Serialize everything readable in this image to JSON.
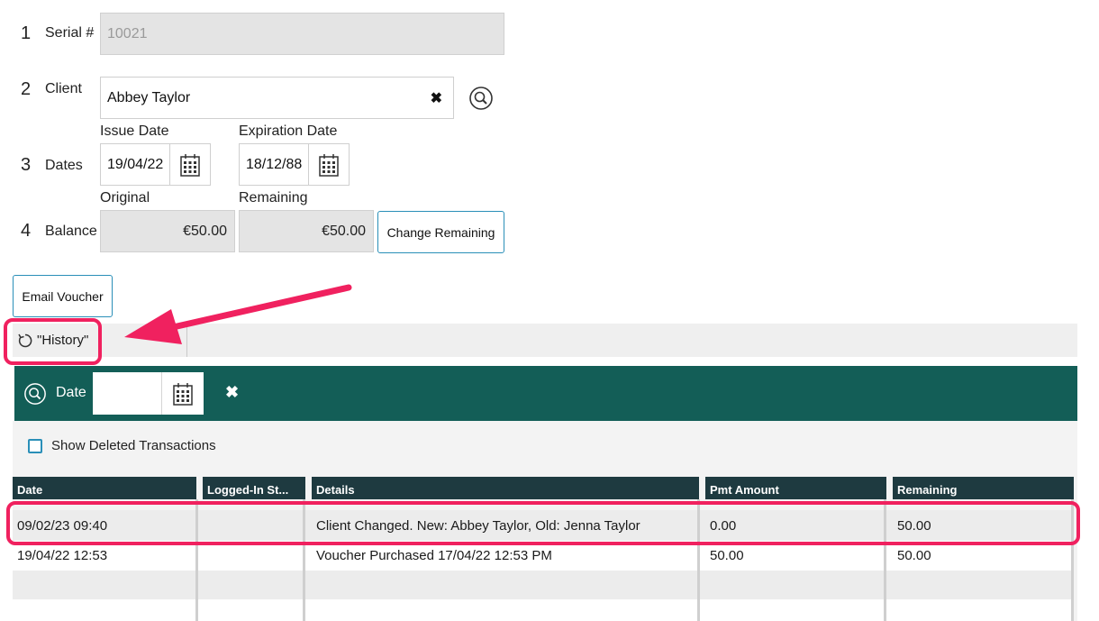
{
  "form": {
    "serial": {
      "num": "1",
      "label": "Serial #",
      "value": "10021"
    },
    "client": {
      "num": "2",
      "label": "Client",
      "value": "Abbey Taylor"
    },
    "dates": {
      "num": "3",
      "label": "Dates",
      "issue_label": "Issue Date",
      "issue_value": "19/04/22",
      "expiration_label": "Expiration Date",
      "expiration_value": "18/12/88"
    },
    "balance": {
      "num": "4",
      "label": "Balance",
      "original_label": "Original",
      "original_value": "€50.00",
      "remaining_label": "Remaining",
      "remaining_value": "€50.00",
      "change_button": "Change Remaining"
    }
  },
  "email_button": "Email Voucher",
  "tab": {
    "label": "\"History\""
  },
  "filter": {
    "date_label": "Date",
    "date_value": ""
  },
  "show_deleted": {
    "label": "Show Deleted Transactions",
    "checked": false
  },
  "table": {
    "headers": [
      "Date",
      "Logged-In St...",
      "Details",
      "Pmt Amount",
      "Remaining"
    ],
    "rows": [
      [
        "09/02/23 09:40",
        "",
        "Client Changed. New: Abbey Taylor, Old: Jenna Taylor",
        "0.00",
        "50.00"
      ],
      [
        "19/04/22 12:53",
        "",
        "Voucher Purchased 17/04/22 12:53 PM",
        "50.00",
        "50.00"
      ]
    ]
  },
  "colors": {
    "accent_annotation": "#f0215f",
    "filter_bar": "#135e57",
    "table_header": "#1e3a40",
    "button_border": "#2a8fb8"
  }
}
